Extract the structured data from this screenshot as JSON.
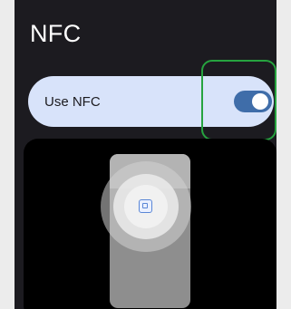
{
  "page": {
    "title": "NFC"
  },
  "nfc_setting": {
    "label": "Use NFC",
    "enabled": true,
    "accent_color": "#3f6da9",
    "row_bg": "#d8e3fa"
  },
  "illustration": {
    "icon": "nfc-chip-icon"
  },
  "annotation": {
    "highlight_color": "#26a33f"
  }
}
